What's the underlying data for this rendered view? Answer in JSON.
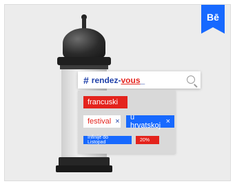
{
  "badge": {
    "label": "Bē"
  },
  "search": {
    "hash": "#",
    "query_blue": "rendez-",
    "query_red": "vous",
    "tail": "_"
  },
  "tags": {
    "francuski": "francuski",
    "festival": "festival",
    "festival_x": "×",
    "hrvatska": "u hrvatskoj",
    "hrvatska_x": "×",
    "date": "Infinije do Listopad",
    "pct": "20%"
  },
  "colors": {
    "accent_blue": "#1769ff",
    "accent_red": "#e4231c",
    "text_blue": "#1e3fa8"
  }
}
